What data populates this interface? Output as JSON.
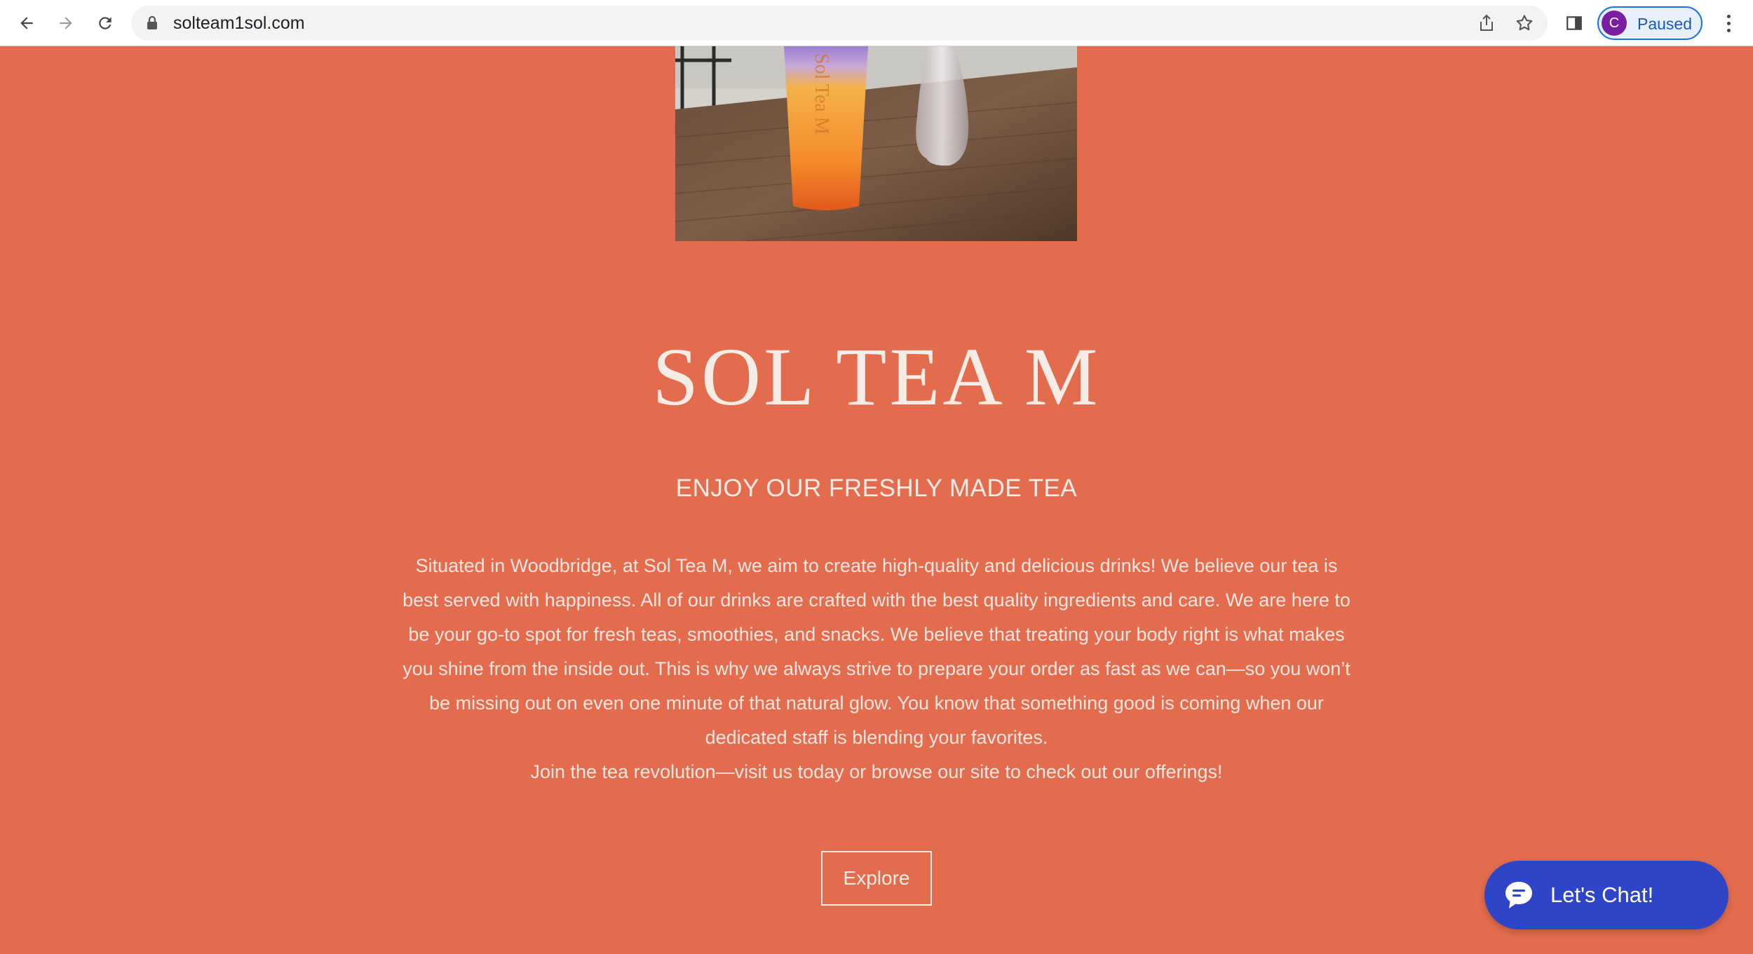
{
  "browser": {
    "url": "solteam1sol.com",
    "profile_initial": "C",
    "profile_status": "Paused",
    "icons": [
      "back-arrow-icon",
      "forward-arrow-icon",
      "reload-icon",
      "lock-icon",
      "share-icon",
      "bookmark-star-icon",
      "side-panel-icon",
      "kebab-menu-icon"
    ]
  },
  "hero": {
    "cup_text": "Sol Tea M",
    "title": "SOL TEA M",
    "tagline": "ENJOY OUR FRESHLY MADE TEA",
    "paragraph_1": "Situated in Woodbridge, at Sol Tea M, we aim to create high-quality and delicious drinks! We believe our tea is best served with happiness. All of our drinks are crafted with the best quality ingredients and care. We are here to be your go-to spot for fresh teas, smoothies, and snacks. We believe that treating your body right is what makes you shine from the inside out. This is why we always strive to prepare your order as fast as we can—so you won’t be missing out on even one minute of that natural glow. You know that something good is coming when our dedicated staff is blending your favorites.",
    "paragraph_2": "Join the tea revolution—visit us today or browse our site to check out our offerings!",
    "explore_label": "Explore"
  },
  "chat": {
    "label": "Let's Chat!",
    "icon": "chat-bubble-icon"
  },
  "colors": {
    "page_background": "#e36c4e",
    "text_light": "#f6ece6",
    "chat_button": "#2f45c8",
    "profile_avatar": "#7b1fa2"
  }
}
